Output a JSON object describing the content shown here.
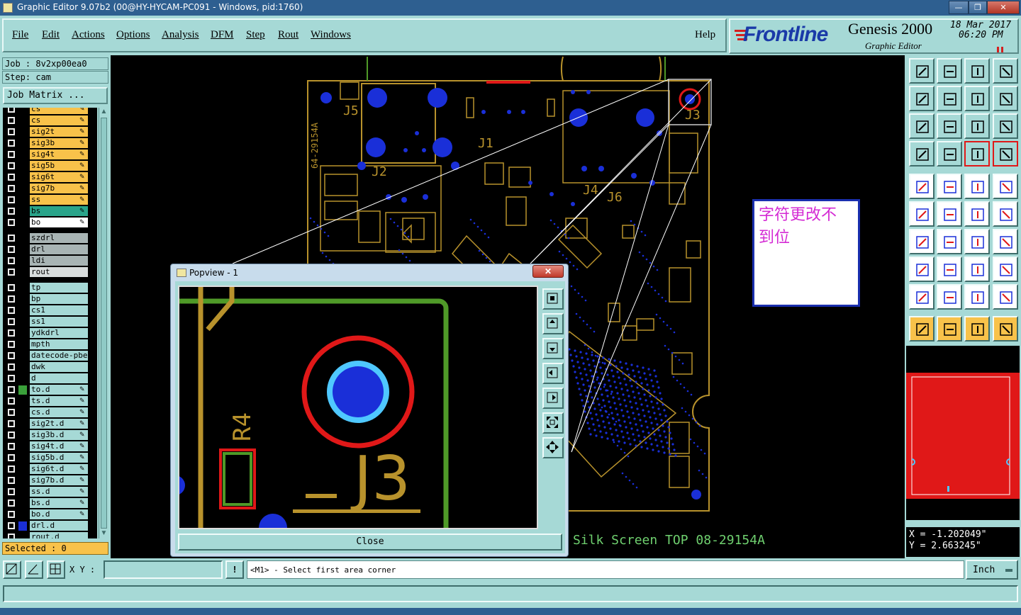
{
  "window": {
    "title": "Graphic Editor 9.07b2 (00@HY-HYCAM-PC091 - Windows, pid:1760)",
    "min_label": "—",
    "max_label": "❐",
    "close_label": "✕"
  },
  "menu": {
    "items": [
      "File",
      "Edit",
      "Actions",
      "Options",
      "Analysis",
      "DFM",
      "Step",
      "Rout",
      "Windows"
    ],
    "help": "Help"
  },
  "brand": {
    "logo": "Frontline",
    "product": "Genesis 2000",
    "subtitle": "Graphic Editor",
    "date": "18 Mar 2017",
    "time": "06:20 PM"
  },
  "job": {
    "job_line": "Job : 8v2xp00ea0",
    "step_line": "Step: cam",
    "matrix_button": "Job Matrix ..."
  },
  "layers": [
    {
      "name": "cs",
      "color": "#f8c24a",
      "edit": true
    },
    {
      "name": "cs",
      "color": "#f8c24a",
      "edit": true
    },
    {
      "name": "sig2t",
      "color": "#f8c24a",
      "edit": true
    },
    {
      "name": "sig3b",
      "color": "#f8c24a",
      "edit": true
    },
    {
      "name": "sig4t",
      "color": "#f8c24a",
      "edit": true
    },
    {
      "name": "sig5b",
      "color": "#f8c24a",
      "edit": true
    },
    {
      "name": "sig6t",
      "color": "#f8c24a",
      "edit": true
    },
    {
      "name": "sig7b",
      "color": "#f8c24a",
      "edit": true
    },
    {
      "name": "ss",
      "color": "#f8c24a",
      "edit": true
    },
    {
      "name": "bs",
      "color": "#2aa48a",
      "edit": true
    },
    {
      "name": "bo",
      "color": "#ffffff",
      "edit": true
    },
    {
      "name": "szdrl",
      "color": "#a8b4b4",
      "edit": false
    },
    {
      "name": "drl",
      "color": "#a8b4b4",
      "edit": false
    },
    {
      "name": "ldi",
      "color": "#a8b4b4",
      "edit": false
    },
    {
      "name": "rout",
      "color": "#d8dcdc",
      "edit": false
    },
    {
      "name": "tp",
      "color": "#a6d9d6",
      "edit": false
    },
    {
      "name": "bp",
      "color": "#a6d9d6",
      "edit": false
    },
    {
      "name": "cs1",
      "color": "#a6d9d6",
      "edit": false
    },
    {
      "name": "ss1",
      "color": "#a6d9d6",
      "edit": false
    },
    {
      "name": "ydkdrl",
      "color": "#a6d9d6",
      "edit": false
    },
    {
      "name": "mpth",
      "color": "#a6d9d6",
      "edit": false
    },
    {
      "name": "datecode-pbe",
      "color": "#a6d9d6",
      "edit": false
    },
    {
      "name": "dwk",
      "color": "#a6d9d6",
      "edit": false
    },
    {
      "name": "d",
      "color": "#a6d9d6",
      "edit": false
    },
    {
      "name": "to.d",
      "color": "#a6d9d6",
      "edit": true,
      "swatch": "#3aa03a"
    },
    {
      "name": "ts.d",
      "color": "#a6d9d6",
      "edit": true
    },
    {
      "name": "cs.d",
      "color": "#a6d9d6",
      "edit": true
    },
    {
      "name": "sig2t.d",
      "color": "#a6d9d6",
      "edit": true
    },
    {
      "name": "sig3b.d",
      "color": "#a6d9d6",
      "edit": true
    },
    {
      "name": "sig4t.d",
      "color": "#a6d9d6",
      "edit": true
    },
    {
      "name": "sig5b.d",
      "color": "#a6d9d6",
      "edit": true
    },
    {
      "name": "sig6t.d",
      "color": "#a6d9d6",
      "edit": true
    },
    {
      "name": "sig7b.d",
      "color": "#a6d9d6",
      "edit": true
    },
    {
      "name": "ss.d",
      "color": "#a6d9d6",
      "edit": true
    },
    {
      "name": "bs.d",
      "color": "#a6d9d6",
      "edit": true
    },
    {
      "name": "bo.d",
      "color": "#a6d9d6",
      "edit": true
    },
    {
      "name": "drl.d",
      "color": "#a6d9d6",
      "edit": false,
      "swatch": "#1a2fd8"
    },
    {
      "name": "rout.d",
      "color": "#a6d9d6",
      "edit": false
    }
  ],
  "selected": "Selected : 0",
  "canvas": {
    "silk_label": "Silk Screen TOP 08-29154A",
    "board_side_label": "64-29154A",
    "ref_j1": "J1",
    "ref_j2": "J2",
    "ref_j3": "J3",
    "ref_j4": "J4",
    "ref_j5": "J5",
    "ref_j6": "J6"
  },
  "note": {
    "text_line1": "字符更改不",
    "text_line2": "到位"
  },
  "popup": {
    "title": "Popview - 1",
    "close_button": "Close",
    "ref_j3": "J3",
    "ref_r4": "R4"
  },
  "coords": {
    "x": "X = -1.202049\"",
    "y": "Y = 2.663245\""
  },
  "status": {
    "xy_label": "X Y :",
    "xy_value": "",
    "message": "<M1> - Select first area corner",
    "units": "Inch"
  },
  "colors": {
    "panel": "#a6d9d6",
    "trace": "#b8922c",
    "pad": "#1a2fd8",
    "highlight": "#e01818",
    "outline_green": "#4f9a28"
  }
}
